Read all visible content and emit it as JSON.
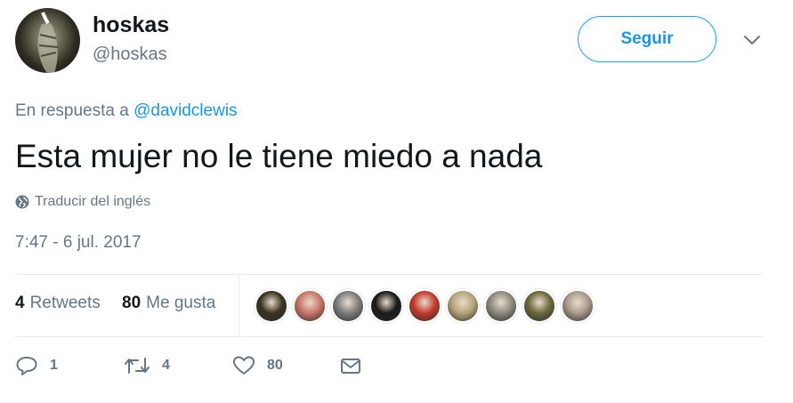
{
  "user": {
    "display_name": "hoskas",
    "screen_name": "@hoskas"
  },
  "follow_button": {
    "label": "Seguir"
  },
  "reply": {
    "prefix": "En respuesta a",
    "mention": "@davidclewis"
  },
  "tweet": {
    "text": "Esta mujer no le tiene miedo a nada",
    "translate_label": "Traducir del inglés",
    "timestamp": "7:47 - 6 jul. 2017"
  },
  "stats": {
    "retweets_count": "4",
    "retweets_label": "Retweets",
    "likes_count": "80",
    "likes_label": "Me gusta"
  },
  "likers": {
    "count": 9,
    "colors": [
      "#3b3320",
      "#c9776a",
      "#7d7d7d",
      "#1a1a1a",
      "#c43b2e",
      "#b6a57a",
      "#8d8a7e",
      "#6b6a3c",
      "#a99a8b"
    ]
  },
  "actions": {
    "reply_count": "1",
    "retweet_count": "4",
    "like_count": "80"
  },
  "colors": {
    "accent": "#1da1f2",
    "link": "#1b95e0",
    "secondary_text": "#657786",
    "primary_text": "#14171a",
    "border": "#e6ecf0"
  },
  "icons": {
    "caret": "chevron-down-icon",
    "translate": "globe-icon",
    "reply": "reply-icon",
    "retweet": "retweet-icon",
    "like": "heart-icon",
    "message": "envelope-icon"
  }
}
